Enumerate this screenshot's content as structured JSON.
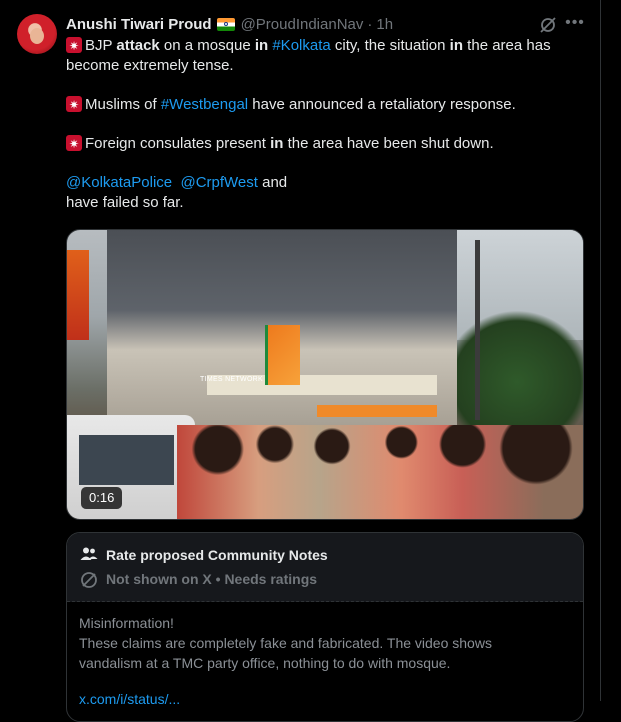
{
  "tweet": {
    "author_name": "Anushi Tiwari Proud",
    "handle": "@ProudIndianNav",
    "separator": "·",
    "time": "1h",
    "paragraph1": {
      "p1": "BJP ",
      "b1": "attack",
      "p2": " on a mosque ",
      "b2": "in",
      "p3": " ",
      "hashtag": "#Kolkata",
      "p4": " city, the situation ",
      "b3": "in",
      "p5": " the area has become extremely tense."
    },
    "paragraph2": {
      "p1": "Muslims of ",
      "hashtag": "#Westbengal",
      "p2": " have announced a retaliatory response."
    },
    "paragraph3": {
      "p1": "Foreign consulates present ",
      "b1": "in",
      "p2": " the area have been shut down."
    },
    "paragraph4": {
      "mention1": "@KolkataPolice",
      "mention2": "@CrpfWest",
      "p1": " and",
      "line2": "have failed so far."
    }
  },
  "video": {
    "duration": "0:16",
    "watermark": "TIMES NETWORK"
  },
  "community_notes": {
    "title": "Rate proposed Community Notes",
    "status": "Not shown on X • Needs ratings",
    "note_heading": "Misinformation!",
    "note_text": "These claims are completely fake and fabricated. The video shows vandalism at a TMC party office, nothing to do with mosque.",
    "note_link": "x.com/i/status/..."
  },
  "icons": {
    "grok": "grok-icon",
    "more": "more-icon",
    "siren": "siren-icon",
    "people": "people-icon",
    "eye_off": "eye-off-icon"
  },
  "colors": {
    "background": "#000000",
    "text": "#e7e9ea",
    "muted": "#71767b",
    "link": "#1d9bf0",
    "notes_panel": "#16181c"
  }
}
